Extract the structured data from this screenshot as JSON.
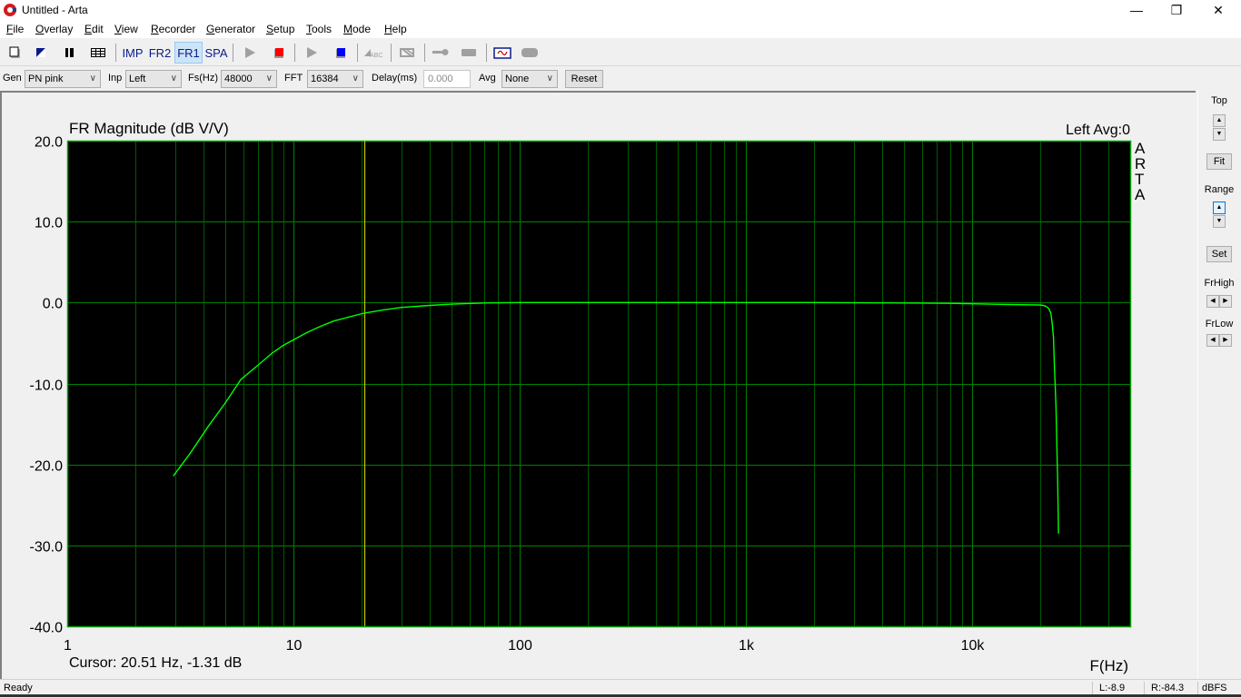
{
  "window": {
    "title": "Untitled - Arta",
    "minimize_glyph": "—",
    "restore_glyph": "❐",
    "close_glyph": "✕"
  },
  "menu": [
    {
      "label": "File",
      "u": "F",
      "rest": "ile"
    },
    {
      "label": "Overlay",
      "u": "O",
      "rest": "verlay"
    },
    {
      "label": "Edit",
      "u": "E",
      "rest": "dit"
    },
    {
      "label": "View",
      "u": "V",
      "rest": "iew"
    },
    {
      "label": "Recorder",
      "u": "R",
      "rest": "ecorder"
    },
    {
      "label": "Generator",
      "u": "G",
      "rest": "enerator"
    },
    {
      "label": "Setup",
      "u": "S",
      "rest": "etup"
    },
    {
      "label": "Tools",
      "u": "T",
      "rest": "ools"
    },
    {
      "label": "Mode",
      "u": "M",
      "rest": "ode"
    },
    {
      "label": "Help",
      "u": "H",
      "rest": "elp"
    }
  ],
  "toolbar": {
    "icons": [
      "new-file-icon",
      "open-icon",
      "pause-icon",
      "table-icon"
    ],
    "modes": [
      {
        "label": "IMP",
        "active": false
      },
      {
        "label": "FR2",
        "active": false
      },
      {
        "label": "FR1",
        "active": true
      },
      {
        "label": "SPA",
        "active": false
      }
    ],
    "transport": [
      "play-gen-icon",
      "stop-gen-icon",
      "play-rec-icon",
      "stop-rec-icon",
      "abc-icon",
      "grid-off-icon",
      "key-icon",
      "bar-icon",
      "scope-icon",
      "round-icon"
    ],
    "abc_text": "ABC",
    "colors": {
      "stop_gen": "#ff0000",
      "stop_rec": "#0000ff",
      "scope_wave": "#c00000",
      "scope_frame": "#0a1a8a",
      "disabled": "#a0a0a0"
    }
  },
  "params": {
    "gen_label": "Gen",
    "gen_value": "PN pink",
    "inp_label": "Inp",
    "inp_value": "Left",
    "fs_label": "Fs(Hz)",
    "fs_value": "48000",
    "fft_label": "FFT",
    "fft_value": "16384",
    "delay_label": "Delay(ms)",
    "delay_value": "0.000",
    "avg_label": "Avg",
    "avg_value": "None",
    "reset_label": "Reset",
    "chevron": "∨"
  },
  "right_panel": {
    "top_label": "Top",
    "fit_label": "Fit",
    "range_label": "Range",
    "set_label": "Set",
    "frhigh_label": "FrHigh",
    "frlow_label": "FrLow",
    "up": "▲",
    "down": "▼",
    "left": "◀",
    "right": "▶"
  },
  "plot": {
    "channel_info": "Left  Avg:0",
    "brand_letters": [
      "A",
      "R",
      "T",
      "A"
    ],
    "cursor_text": "Cursor: 20.51 Hz, -1.31 dB",
    "colors": {
      "background": "#000000",
      "grid_major": "#008000",
      "grid_minor": "#005a00",
      "border": "#00a000",
      "trace": "#00ff00",
      "cursor": "#c8c800"
    }
  },
  "status": {
    "ready": "Ready",
    "left_level": "L:-8.9",
    "right_level": "R:-84.3",
    "unit": "dBFS"
  },
  "chart_data": {
    "type": "line",
    "title": "FR Magnitude (dB V/V)",
    "xlabel": "F(Hz)",
    "ylabel": "",
    "xscale": "log",
    "xlim": [
      1,
      50000
    ],
    "ylim": [
      -40,
      20
    ],
    "x_ticks": [
      {
        "v": 1,
        "label": "1"
      },
      {
        "v": 10,
        "label": "10"
      },
      {
        "v": 100,
        "label": "100"
      },
      {
        "v": 1000,
        "label": "1k"
      },
      {
        "v": 10000,
        "label": "10k"
      }
    ],
    "y_ticks": [
      {
        "v": 20,
        "label": "20.0"
      },
      {
        "v": 10,
        "label": "10.0"
      },
      {
        "v": 0,
        "label": "0.0"
      },
      {
        "v": -10,
        "label": "-10.0"
      },
      {
        "v": -20,
        "label": "-20.0"
      },
      {
        "v": -30,
        "label": "-30.0"
      },
      {
        "v": -40,
        "label": "-40.0"
      }
    ],
    "grid": true,
    "cursor": {
      "freq_hz": 20.51,
      "db": -1.31
    },
    "series": [
      {
        "name": "Left",
        "x": [
          2.95,
          3.5,
          4.2,
          5.0,
          5.86,
          7.0,
          8.0,
          9.0,
          10.0,
          11.5,
          13.0,
          15.0,
          17.5,
          20.5,
          25.0,
          30.0,
          40.0,
          50.0,
          70.0,
          100.0,
          200.0,
          500.0,
          1000.0,
          2000.0,
          5000.0,
          8000.0,
          10000.0,
          15000.0,
          20000.0,
          21000.0,
          21800.0,
          22300.0,
          22600.0,
          22900.0,
          23100.0,
          23300.0,
          23500.0,
          23700.0,
          23900.0,
          24100.0
        ],
        "y": [
          -21.4,
          -18.6,
          -15.3,
          -12.4,
          -9.5,
          -7.7,
          -6.3,
          -5.3,
          -4.6,
          -3.7,
          -3.0,
          -2.3,
          -1.8,
          -1.31,
          -0.9,
          -0.6,
          -0.35,
          -0.2,
          -0.05,
          0.0,
          0.0,
          0.0,
          0.0,
          0.0,
          -0.05,
          -0.1,
          -0.15,
          -0.25,
          -0.3,
          -0.4,
          -0.7,
          -1.3,
          -2.5,
          -4.3,
          -7.5,
          -10.0,
          -13.0,
          -17.6,
          -22.0,
          -28.5
        ]
      }
    ]
  }
}
